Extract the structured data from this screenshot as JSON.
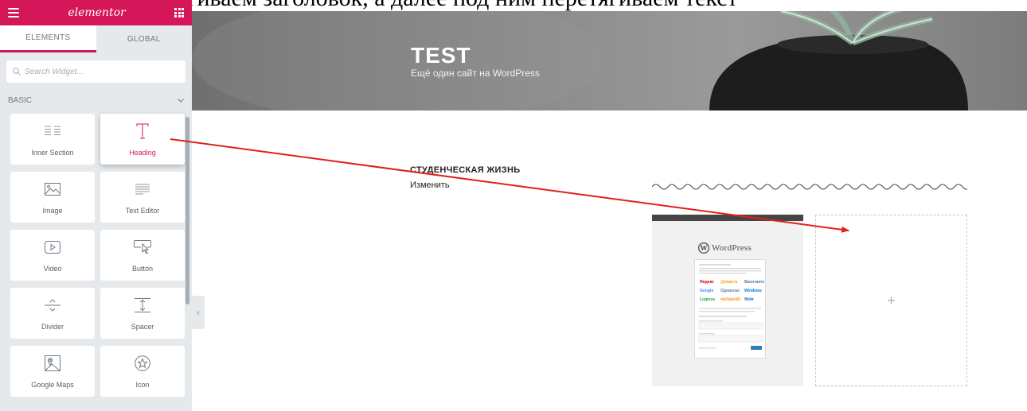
{
  "caption": "сначала перетягиваем заголовок, а далее под ним перетягиваем текст",
  "panel": {
    "brand": "elementor",
    "tabs": [
      {
        "label": "ELEMENTS",
        "active": true
      },
      {
        "label": "GLOBAL",
        "active": false
      }
    ],
    "search_placeholder": "Search Widget...",
    "category": "BASIC",
    "widgets": [
      {
        "label": "Inner Section",
        "icon": "inner-section-icon"
      },
      {
        "label": "Heading",
        "icon": "heading-icon",
        "highlighted": true
      },
      {
        "label": "Image",
        "icon": "image-icon"
      },
      {
        "label": "Text Editor",
        "icon": "text-editor-icon"
      },
      {
        "label": "Video",
        "icon": "video-icon"
      },
      {
        "label": "Button",
        "icon": "button-icon"
      },
      {
        "label": "Divider",
        "icon": "divider-icon"
      },
      {
        "label": "Spacer",
        "icon": "spacer-icon"
      },
      {
        "label": "Google Maps",
        "icon": "google-maps-icon"
      },
      {
        "label": "Icon",
        "icon": "star-icon"
      }
    ],
    "collapse_glyph": "‹"
  },
  "site": {
    "title": "TEST",
    "tagline": "Ещё один сайт на WordPress"
  },
  "post": {
    "title": "СТУДЕНЧЕСКАЯ ЖИЗНЬ",
    "edit_link": "Изменить"
  },
  "thumbnail": {
    "brand": "WordPress"
  },
  "drop_zone": {
    "glyph": "+"
  },
  "colors": {
    "accent": "#d5175a",
    "arrow": "#e0201a"
  }
}
